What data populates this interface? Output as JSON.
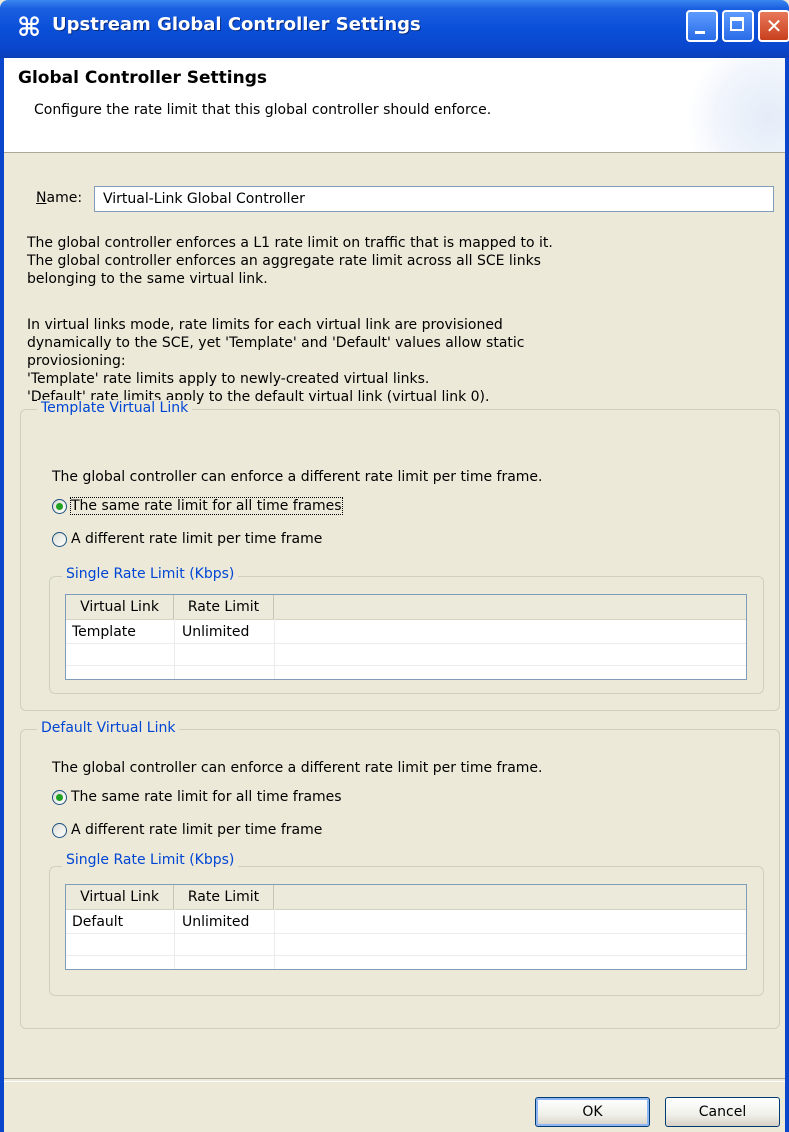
{
  "window": {
    "title": "Upstream Global Controller Settings"
  },
  "header": {
    "title": "Global Controller Settings",
    "description": "Configure the rate limit that this global controller should enforce."
  },
  "name_field": {
    "label": "Name:",
    "value": "Virtual-Link Global Controller"
  },
  "info": {
    "lines_1": [
      "The global controller enforces a L1 rate limit on traffic that is mapped to it.",
      "The global controller enforces an aggregate rate limit across all SCE links",
      "belonging to the same virtual link."
    ],
    "lines_2": [
      "In virtual links mode, rate limits for each virtual link are provisioned",
      "dynamically to the SCE, yet 'Template' and 'Default' values allow static",
      "proviosioning:",
      "'Template' rate limits apply to newly-created virtual links.",
      "'Default' rate limits apply to the default virtual link (virtual link 0)."
    ]
  },
  "template_group": {
    "legend": "Template Virtual Link",
    "description": "The global controller can enforce a different rate limit per time frame.",
    "radio_same": "The same rate limit for all time frames",
    "radio_different": "A different rate limit per time frame",
    "selected": "same",
    "sub_legend": "Single Rate Limit (Kbps)",
    "columns": [
      "Virtual Link",
      "Rate Limit"
    ],
    "rows": [
      {
        "link": "Template",
        "limit": "Unlimited"
      }
    ]
  },
  "default_group": {
    "legend": "Default Virtual Link",
    "description": "The global controller can enforce a different rate limit per time frame.",
    "radio_same": "The same rate limit for all time frames",
    "radio_different": "A different rate limit per time frame",
    "selected": "same",
    "sub_legend": "Single Rate Limit (Kbps)",
    "columns": [
      "Virtual Link",
      "Rate Limit"
    ],
    "rows": [
      {
        "link": "Default",
        "limit": "Unlimited"
      }
    ]
  },
  "buttons": {
    "ok": "OK",
    "cancel": "Cancel"
  },
  "colors": {
    "title_bar": "#0a46cc",
    "legend_text": "#0046d5",
    "radio_dot": "#21a121"
  }
}
